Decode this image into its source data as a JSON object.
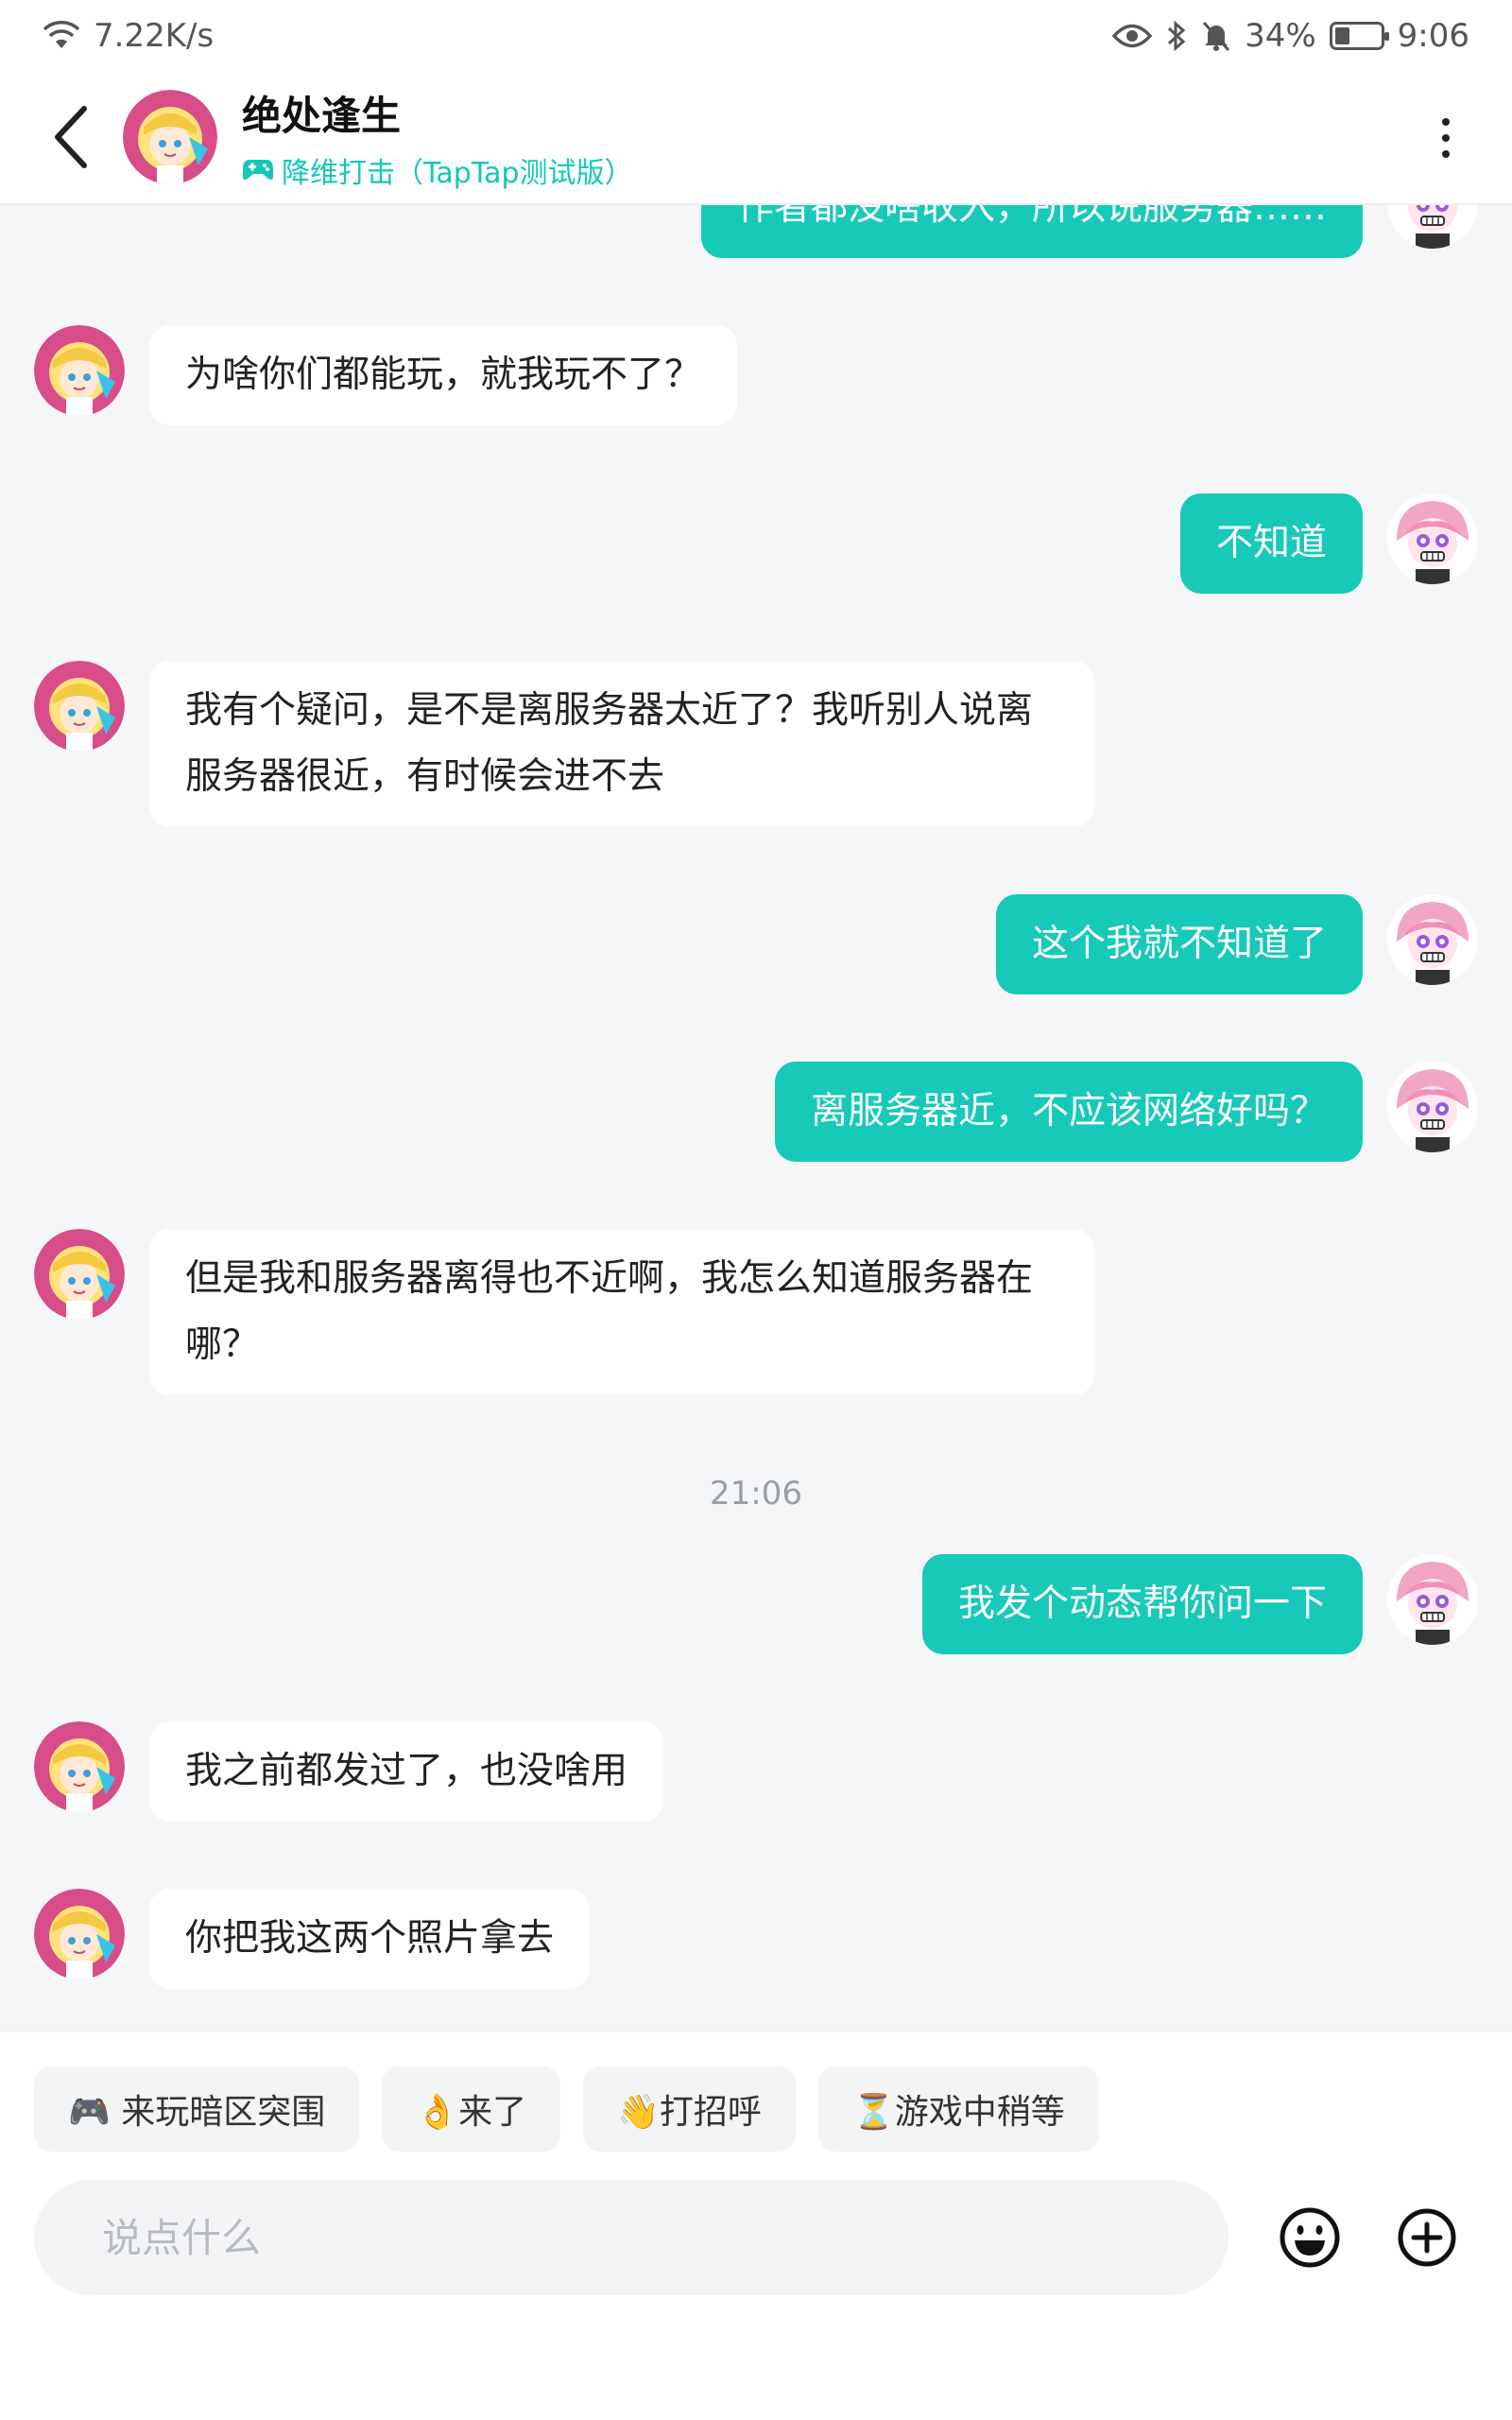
{
  "status_bar": {
    "speed": "7.22K/s",
    "battery": "34%",
    "battery_level": 0.34,
    "time": "9:06"
  },
  "header": {
    "name": "绝处逢生",
    "game": "降维打击（TapTap测试版）"
  },
  "messages": [
    {
      "dir": "out",
      "text": "作者都没啥收入，所以说服务器……"
    },
    {
      "dir": "in",
      "text": "为啥你们都能玩，就我玩不了？"
    },
    {
      "dir": "out",
      "text": "不知道"
    },
    {
      "dir": "in",
      "text": "我有个疑问，是不是离服务器太近了？我听别人说离服务器很近，有时候会进不去"
    },
    {
      "dir": "out",
      "text": "这个我就不知道了"
    },
    {
      "dir": "out",
      "text": "离服务器近，不应该网络好吗？"
    },
    {
      "dir": "in",
      "text": "但是我和服务器离得也不近啊，我怎么知道服务器在哪？"
    },
    {
      "dir": "out",
      "text": "我发个动态帮你问一下"
    },
    {
      "dir": "in",
      "text": "我之前都发过了，也没啥用"
    },
    {
      "dir": "in",
      "text": "你把我这两个照片拿去"
    }
  ],
  "timestamp": "21:06",
  "quick_replies": [
    "🎮 来玩暗区突围",
    "👌来了",
    "👋打招呼",
    "⏳游戏中稍等"
  ],
  "input": {
    "placeholder": "说点什么"
  },
  "colors": {
    "accent": "#17c9b9",
    "background": "#f5f6f8"
  }
}
